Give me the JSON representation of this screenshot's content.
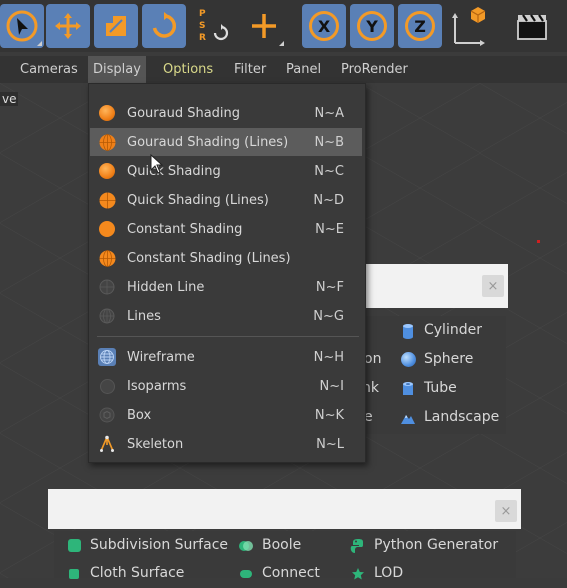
{
  "toolbar": {
    "axis_x": "X",
    "axis_y": "Y",
    "axis_z": "Z",
    "psr_label": "PSR",
    "icons": [
      "select-icon",
      "move-icon",
      "scale-icon",
      "rotate-icon",
      "psr-reset-icon",
      "world-axis-icon",
      "cube-object-icon",
      "coordinate-system-icon",
      "render-clapper-icon"
    ]
  },
  "menubar": {
    "items": [
      "Cameras",
      "Display",
      "Options",
      "Filter",
      "Panel",
      "ProRender"
    ],
    "open_item": "Display",
    "viewport_label": "ve"
  },
  "display_menu": {
    "items": [
      {
        "label": "Gouraud Shading",
        "shortcut": "N~A",
        "icon": "gouraud-shading-icon"
      },
      {
        "label": "Gouraud Shading (Lines)",
        "shortcut": "N~B",
        "icon": "gouraud-lines-icon"
      },
      {
        "label": "Quick Shading",
        "shortcut": "N~C",
        "icon": "quick-shading-icon"
      },
      {
        "label": "Quick Shading (Lines)",
        "shortcut": "N~D",
        "icon": "quick-lines-icon"
      },
      {
        "label": "Constant Shading",
        "shortcut": "N~E",
        "icon": "constant-shading-icon"
      },
      {
        "label": "Constant Shading (Lines)",
        "shortcut": "",
        "icon": "constant-lines-icon"
      },
      {
        "label": "Hidden Line",
        "shortcut": "N~F",
        "icon": "hidden-line-icon"
      },
      {
        "label": "Lines",
        "shortcut": "N~G",
        "icon": "lines-icon"
      },
      {
        "label": "Wireframe",
        "shortcut": "N~H",
        "icon": "wireframe-icon"
      },
      {
        "label": "Isoparms",
        "shortcut": "N~I",
        "icon": "isoparms-icon"
      },
      {
        "label": "Box",
        "shortcut": "N~K",
        "icon": "box-icon"
      },
      {
        "label": "Skeleton",
        "shortcut": "N~L",
        "icon": "skeleton-icon"
      }
    ],
    "hovered_index": 1
  },
  "primitive_panel": {
    "close_glyph": "×",
    "left_fragments": [
      "on",
      "nk",
      "e"
    ],
    "items": [
      {
        "label": "Cylinder",
        "icon": "cylinder-icon"
      },
      {
        "label": "Sphere",
        "icon": "sphere-icon"
      },
      {
        "label": "Tube",
        "icon": "tube-icon"
      },
      {
        "label": "Landscape",
        "icon": "landscape-icon"
      }
    ]
  },
  "generator_panel": {
    "close_glyph": "×",
    "items": [
      {
        "label": "Subdivision Surface",
        "icon": "subdivision-surface-icon"
      },
      {
        "label": "Boole",
        "icon": "boole-icon"
      },
      {
        "label": "Python Generator",
        "icon": "python-generator-icon"
      },
      {
        "label": "Cloth Surface",
        "icon": "cloth-surface-icon"
      },
      {
        "label": "Connect",
        "icon": "connect-icon"
      },
      {
        "label": "LOD",
        "icon": "lod-icon"
      }
    ]
  },
  "colors": {
    "accent_orange": "#f39a27",
    "active_blue": "#5a80b6",
    "menu_bg": "#3a3a3a",
    "hover_bg": "#5c5c5c"
  }
}
